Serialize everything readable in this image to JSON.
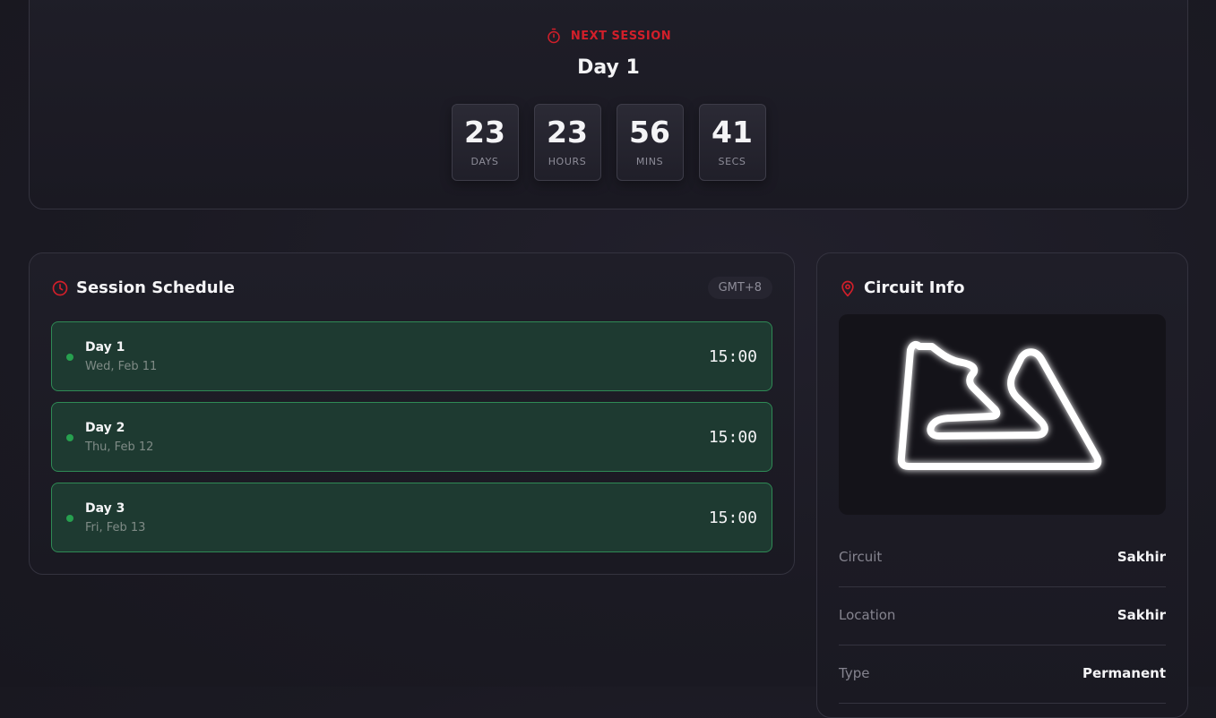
{
  "hero": {
    "label": "NEXT SESSION",
    "title": "Day 1",
    "countdown": [
      {
        "value": "23",
        "unit": "DAYS"
      },
      {
        "value": "23",
        "unit": "HOURS"
      },
      {
        "value": "56",
        "unit": "MINS"
      },
      {
        "value": "41",
        "unit": "SECS"
      }
    ]
  },
  "schedule": {
    "title": "Session Schedule",
    "timezone": "GMT+8",
    "sessions": [
      {
        "name": "Day 1",
        "date": "Wed, Feb 11",
        "time": "15:00"
      },
      {
        "name": "Day 2",
        "date": "Thu, Feb 12",
        "time": "15:00"
      },
      {
        "name": "Day 3",
        "date": "Fri, Feb 13",
        "time": "15:00"
      }
    ]
  },
  "circuit": {
    "title": "Circuit Info",
    "rows": [
      {
        "label": "Circuit",
        "value": "Sakhir"
      },
      {
        "label": "Location",
        "value": "Sakhir"
      },
      {
        "label": "Type",
        "value": "Permanent"
      }
    ]
  },
  "colors": {
    "accent_red": "#d21f2a",
    "session_green_bg": "#1e3a31",
    "session_green_border": "#2f8a55",
    "status_dot": "#27a04f"
  },
  "icons": {
    "next_session": "stopwatch-icon",
    "schedule": "clock-icon",
    "circuit": "map-pin-icon"
  }
}
